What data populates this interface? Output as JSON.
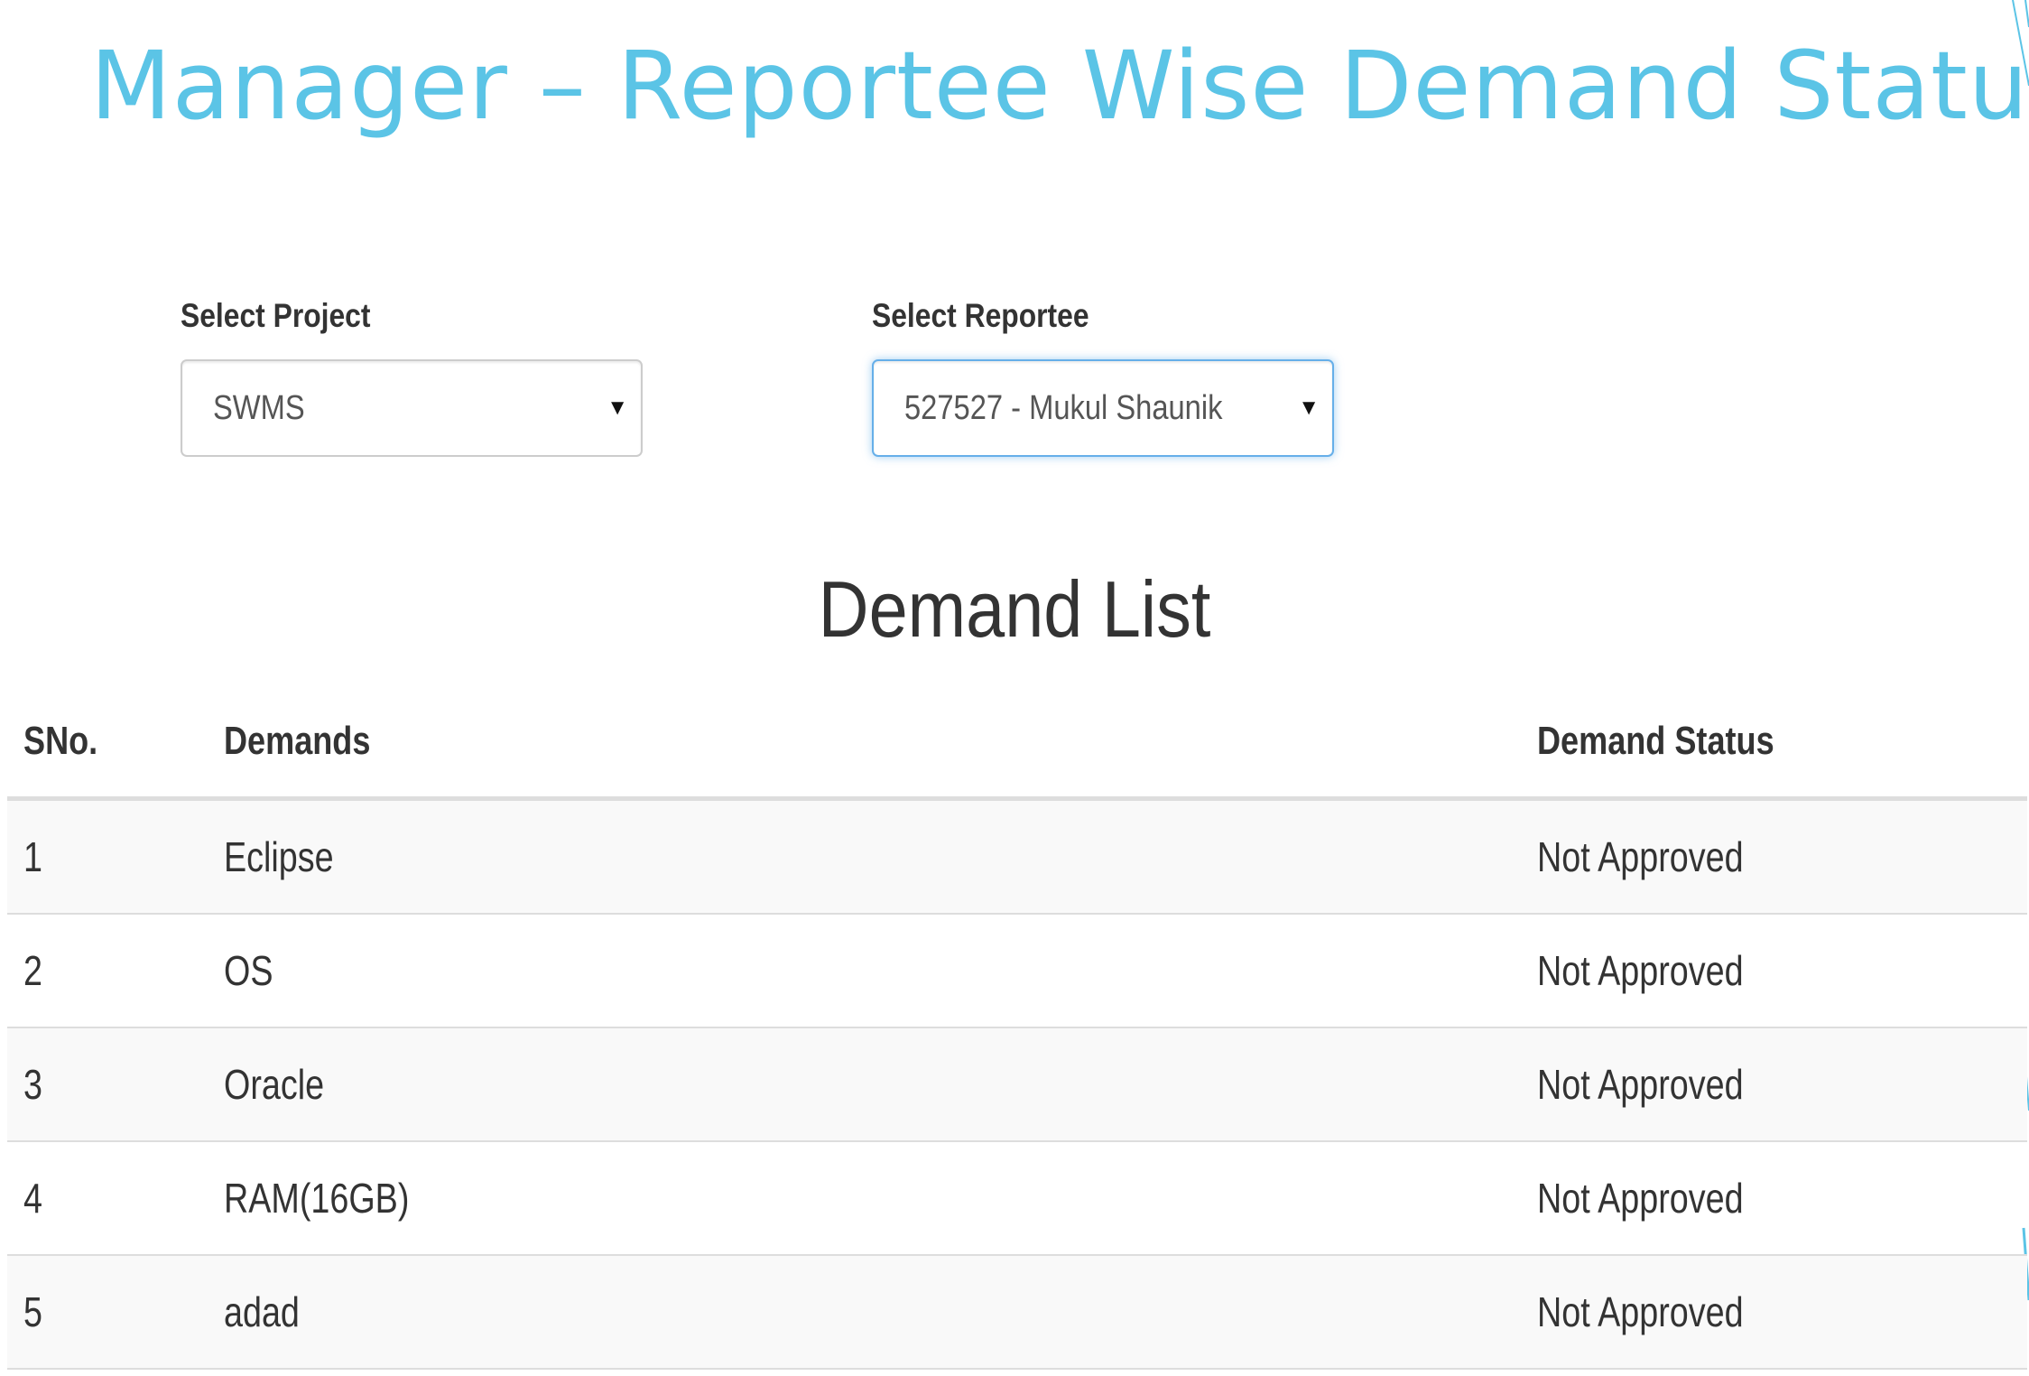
{
  "title": "Manager – Reportee Wise Demand Status",
  "filters": {
    "project": {
      "label": "Select Project",
      "value": "SWMS"
    },
    "reportee": {
      "label": "Select Reportee",
      "value": "527527 - Mukul Shaunik"
    }
  },
  "list_heading": "Demand List",
  "table": {
    "headers": {
      "sno": "SNo.",
      "demands": "Demands",
      "status": "Demand Status"
    },
    "rows": [
      {
        "sno": "1",
        "demand": "Eclipse",
        "status": "Not Approved"
      },
      {
        "sno": "2",
        "demand": "OS",
        "status": "Not Approved"
      },
      {
        "sno": "3",
        "demand": "Oracle",
        "status": "Not Approved"
      },
      {
        "sno": "4",
        "demand": "RAM(16GB)",
        "status": "Not Approved"
      },
      {
        "sno": "5",
        "demand": "adad",
        "status": "Not Approved"
      }
    ]
  },
  "colors": {
    "title": "#5bc4e6",
    "focus_border": "#66afe9",
    "stripe": "#f9f9f9"
  }
}
